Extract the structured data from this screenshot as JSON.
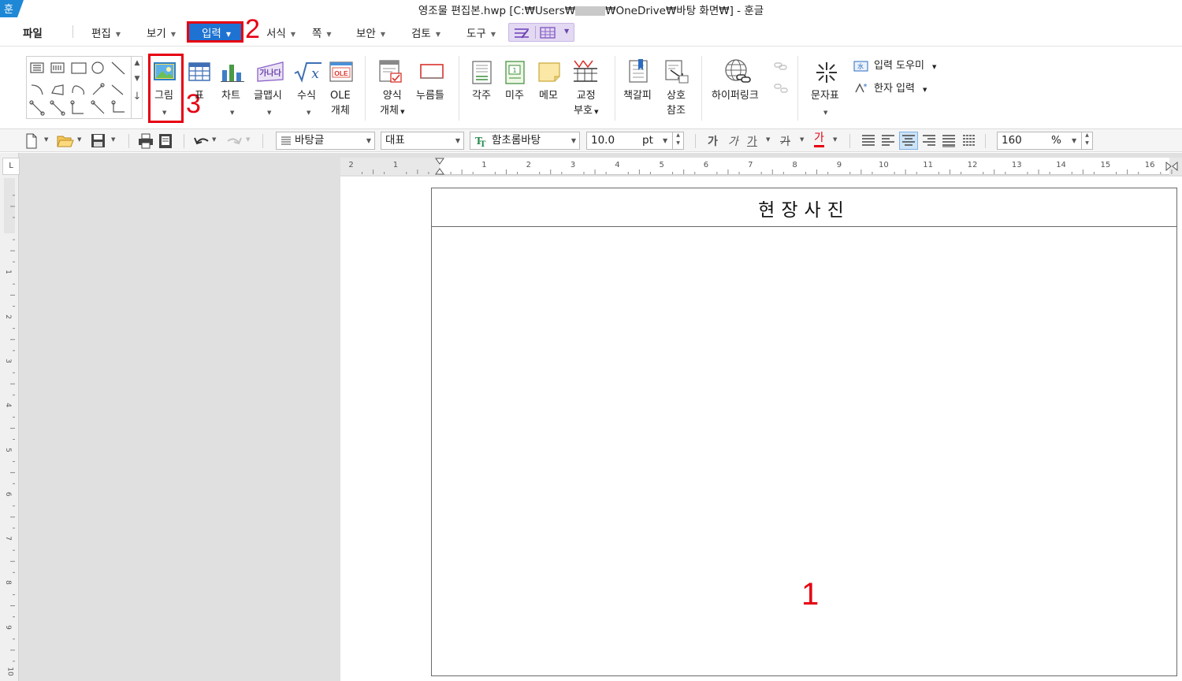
{
  "window": {
    "title_prefix": "영조물 편집본.hwp [C:₩Users₩",
    "title_suffix": "₩OneDrive₩바탕 화면₩] - 훈글",
    "logo_glyph": "훈"
  },
  "menu": {
    "file": "파일",
    "edit": "편집",
    "view": "보기",
    "input": "입력",
    "format": "서식",
    "page": "쪽",
    "security": "보안",
    "review": "검토",
    "tools": "도구"
  },
  "ribbon": {
    "picture": "그림",
    "table": "표",
    "chart": "차트",
    "wordart": "글맵시",
    "formula": "수식",
    "ole_line1": "OLE",
    "ole_line2": "개체",
    "ole_icon_text": "OLE",
    "wordart_icon_text": "가나다",
    "form_line1": "양식",
    "form_line2": "개체",
    "button": "누름틀",
    "footnote": "각주",
    "endnote": "미주",
    "memo": "메모",
    "proof_line1": "교정",
    "proof_line2": "부호",
    "bookmark": "책갈피",
    "crossref_line1": "상호",
    "crossref_line2": "참조",
    "hyperlink": "하이퍼링크",
    "charmap": "문자표",
    "input_helper": "입력 도우미",
    "hanja_input": "한자 입력"
  },
  "format_toolbar": {
    "style": "바탕글",
    "language": "대표",
    "font": "함초롬바탕",
    "font_size": "10.0",
    "size_unit": "pt",
    "zoom": "160",
    "zoom_unit": "%",
    "bold_glyph": "가",
    "italic_glyph": "가",
    "underline_glyph": "가",
    "strike_glyph": "가",
    "color_glyph": "가",
    "font_color": "#e60012"
  },
  "ruler": {
    "h_labels": [
      "2",
      "1",
      "1",
      "2",
      "3",
      "4",
      "5",
      "6",
      "7",
      "8",
      "9",
      "10",
      "11",
      "12",
      "13",
      "14",
      "15",
      "16"
    ],
    "v_labels": [
      "1",
      "2",
      "3",
      "4",
      "5",
      "6",
      "7",
      "8",
      "9",
      "10"
    ],
    "corner_glyph": "L"
  },
  "document": {
    "table_header": "현장사진"
  },
  "annotations": {
    "step1": "1",
    "step2": "2",
    "step3": "3",
    "color": "#e60012"
  },
  "colors": {
    "accent_menu": "#1e73d2",
    "annotation": "#e60012"
  }
}
